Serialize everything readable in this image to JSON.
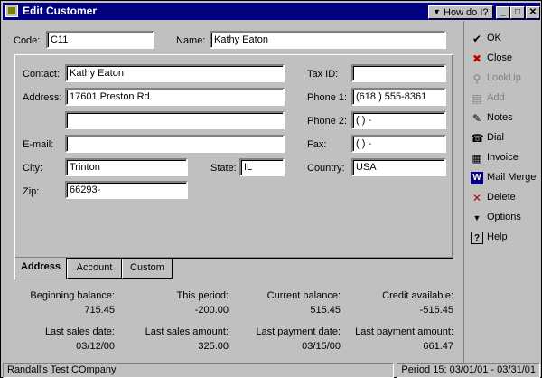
{
  "window": {
    "title": "Edit Customer",
    "howdo": "How do I?"
  },
  "code": {
    "label": "Code:",
    "value": "C11"
  },
  "name": {
    "label": "Name:",
    "value": "Kathy Eaton"
  },
  "address_tab": {
    "contact": {
      "label": "Contact:",
      "value": "Kathy Eaton"
    },
    "address": {
      "label": "Address:",
      "line1": "17601 Preston Rd.",
      "line2": ""
    },
    "email": {
      "label": "E-mail:",
      "value": ""
    },
    "city": {
      "label": "City:",
      "value": "Trinton"
    },
    "state": {
      "label": "State:",
      "value": "IL"
    },
    "zip": {
      "label": "Zip:",
      "value": "66293-"
    },
    "taxid": {
      "label": "Tax ID:",
      "value": ""
    },
    "phone1": {
      "label": "Phone 1:",
      "value": "(618 )  555-8361"
    },
    "phone2": {
      "label": "Phone 2:",
      "value": "(        )         -"
    },
    "fax": {
      "label": "Fax:",
      "value": "(        )         -"
    },
    "country": {
      "label": "Country:",
      "value": "USA"
    }
  },
  "tabs": [
    "Address",
    "Account",
    "Custom"
  ],
  "summary": {
    "beginning_balance": {
      "label": "Beginning balance:",
      "value": "715.45"
    },
    "this_period": {
      "label": "This period:",
      "value": "-200.00"
    },
    "current_balance": {
      "label": "Current balance:",
      "value": "515.45"
    },
    "credit_available": {
      "label": "Credit available:",
      "value": "-515.45"
    },
    "last_sales_date": {
      "label": "Last sales date:",
      "value": "03/12/00"
    },
    "last_sales_amount": {
      "label": "Last sales amount:",
      "value": "325.00"
    },
    "last_payment_date": {
      "label": "Last payment date:",
      "value": "03/15/00"
    },
    "last_payment_amount": {
      "label": "Last payment amount:",
      "value": "661.47"
    }
  },
  "side_buttons": [
    "OK",
    "Close",
    "LookUp",
    "Add",
    "Notes",
    "Dial",
    "Invoice",
    "Mail Merge",
    "Delete",
    "Options",
    "Help"
  ],
  "status": {
    "company": "Randall's Test COmpany",
    "period": "Period 15: 03/01/01 - 03/31/01"
  }
}
